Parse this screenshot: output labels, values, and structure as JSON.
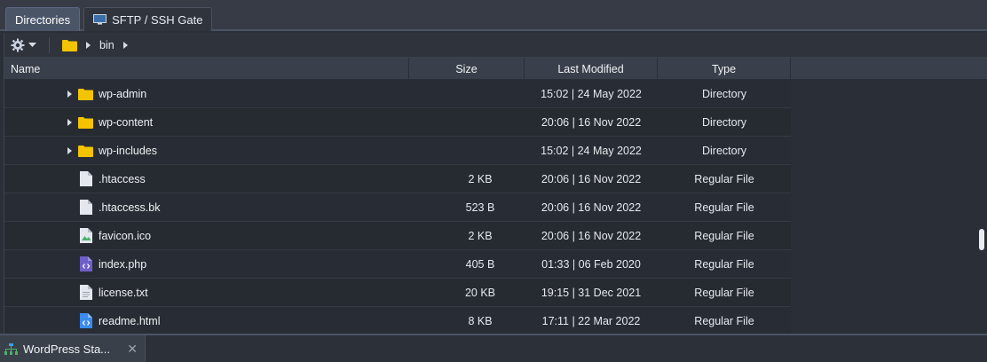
{
  "tabs": [
    {
      "label": "Directories",
      "active": true
    },
    {
      "label": "SFTP / SSH Gate",
      "active": false
    }
  ],
  "breadcrumb": {
    "current": "bin"
  },
  "columns": {
    "name": "Name",
    "size": "Size",
    "modified": "Last Modified",
    "type": "Type"
  },
  "files": [
    {
      "name": "wp-admin",
      "size": "",
      "modified": "15:02 | 24 May 2022",
      "type": "Directory",
      "icon": "folder-icon"
    },
    {
      "name": "wp-content",
      "size": "",
      "modified": "20:06 | 16 Nov 2022",
      "type": "Directory",
      "icon": "folder-icon"
    },
    {
      "name": "wp-includes",
      "size": "",
      "modified": "15:02 | 24 May 2022",
      "type": "Directory",
      "icon": "folder-icon"
    },
    {
      "name": ".htaccess",
      "size": "2 KB",
      "modified": "20:06 | 16 Nov 2022",
      "type": "Regular File",
      "icon": "file-icon"
    },
    {
      "name": ".htaccess.bk",
      "size": "523 B",
      "modified": "20:06 | 16 Nov 2022",
      "type": "Regular File",
      "icon": "file-icon"
    },
    {
      "name": "favicon.ico",
      "size": "2 KB",
      "modified": "20:06 | 16 Nov 2022",
      "type": "Regular File",
      "icon": "image-file-icon"
    },
    {
      "name": "index.php",
      "size": "405 B",
      "modified": "01:33 | 06 Feb 2020",
      "type": "Regular File",
      "icon": "php-file-icon"
    },
    {
      "name": "license.txt",
      "size": "20 KB",
      "modified": "19:15 | 31 Dec 2021",
      "type": "Regular File",
      "icon": "text-file-icon"
    },
    {
      "name": "readme.html",
      "size": "8 KB",
      "modified": "17:11 | 22 Mar 2022",
      "type": "Regular File",
      "icon": "html-file-icon"
    }
  ],
  "bottom_tab": {
    "label": "WordPress Sta...",
    "close": "✕"
  },
  "colors": {
    "folder": "#f5c400",
    "php": "#6e5ec8",
    "html": "#3b8bf0",
    "image": "#4caf6a",
    "accent": "#4a5568"
  }
}
